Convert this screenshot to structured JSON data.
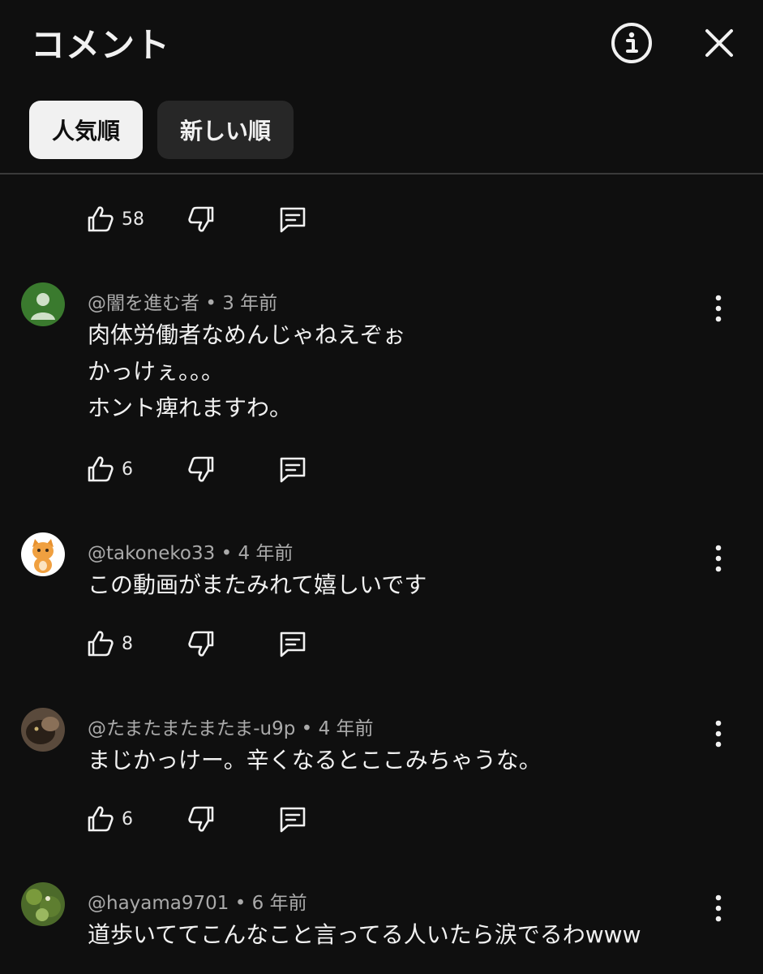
{
  "header": {
    "title": "コメント"
  },
  "tabs": [
    {
      "label": "人気順",
      "active": true
    },
    {
      "label": "新しい順",
      "active": false
    }
  ],
  "first_actions": {
    "likes": "58"
  },
  "comments": [
    {
      "handle": "@闇を進む者",
      "time": "3 年前",
      "lines": [
        "肉体労働者なめんじゃねえぞぉ",
        "かっけぇ。。。",
        "ホント痺れますわ。"
      ],
      "likes": "6"
    },
    {
      "handle": "@takoneko33",
      "time": "4 年前",
      "lines": [
        "この動画がまたみれて嬉しいです"
      ],
      "likes": "8"
    },
    {
      "handle": "@たまたまたまたま-u9p",
      "time": "4 年前",
      "lines": [
        "まじかっけー。辛くなるとここみちゃうな。"
      ],
      "likes": "6"
    },
    {
      "handle": "@hayama9701",
      "time": "6 年前",
      "lines": [
        "道歩いててこんなこと言ってる人いたら涙でるわwww"
      ]
    }
  ],
  "colors": {
    "background": "#0f0f0f",
    "text": "#f1f1f1",
    "meta": "#aaaaaa",
    "chip_inactive": "#272727"
  }
}
